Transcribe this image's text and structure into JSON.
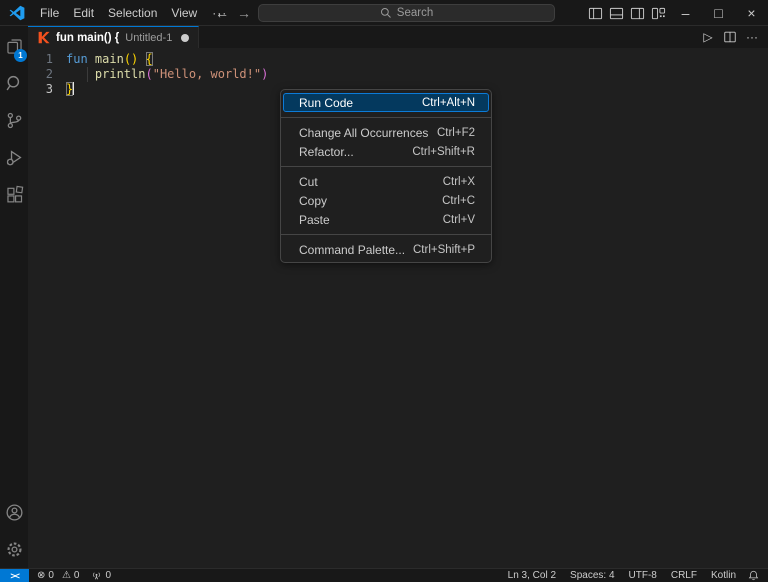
{
  "titlebar": {
    "menus": [
      {
        "label": "File"
      },
      {
        "label": "Edit"
      },
      {
        "label": "Selection"
      },
      {
        "label": "View"
      }
    ],
    "overflow_label": "···",
    "search": {
      "placeholder": "Search"
    }
  },
  "tabbar": {
    "tab": {
      "title": "fun main() {",
      "description": "Untitled-1",
      "modified": true,
      "language": "kotlin"
    }
  },
  "activity_bar": {
    "explorer_badge": "1"
  },
  "editor": {
    "lines": [
      {
        "num": "1",
        "tokens": [
          {
            "text": "fun ",
            "style": "keyword"
          },
          {
            "text": "main",
            "style": "function"
          },
          {
            "text": "()",
            "style": "bracket1"
          },
          {
            "text": " ",
            "style": "plain"
          },
          {
            "text": "{",
            "style": "bracket1",
            "matched": true
          }
        ]
      },
      {
        "num": "2",
        "tokens": [
          {
            "text": "    ",
            "style": "plain"
          },
          {
            "text": "println",
            "style": "function"
          },
          {
            "text": "(",
            "style": "bracket2"
          },
          {
            "text": "\"Hello, world!\"",
            "style": "string"
          },
          {
            "text": ")",
            "style": "bracket2"
          }
        ]
      },
      {
        "num": "3",
        "active": true,
        "cursor_after": true,
        "tokens": [
          {
            "text": "}",
            "style": "bracket1",
            "matched": true
          }
        ]
      }
    ]
  },
  "context_menu": {
    "items": [
      {
        "label": "Run Code",
        "shortcut": "Ctrl+Alt+N",
        "highlighted": true
      },
      {
        "separator": true
      },
      {
        "label": "Change All Occurrences",
        "shortcut": "Ctrl+F2"
      },
      {
        "label": "Refactor...",
        "shortcut": "Ctrl+Shift+R"
      },
      {
        "separator": true
      },
      {
        "label": "Cut",
        "shortcut": "Ctrl+X"
      },
      {
        "label": "Copy",
        "shortcut": "Ctrl+C"
      },
      {
        "label": "Paste",
        "shortcut": "Ctrl+V"
      },
      {
        "separator": true
      },
      {
        "label": "Command Palette...",
        "shortcut": "Ctrl+Shift+P"
      }
    ]
  },
  "statusbar": {
    "remote_label": "><",
    "errors": "0",
    "warnings": "0",
    "ports": "0",
    "right": [
      {
        "label": "Ln 3, Col 2"
      },
      {
        "label": "Spaces: 4"
      },
      {
        "label": "UTF-8"
      },
      {
        "label": "CRLF"
      },
      {
        "label": "Kotlin"
      }
    ]
  },
  "icons": {
    "back_arrow": "←",
    "forward_arrow": "→",
    "minimize": "–",
    "maximize": "□",
    "close": "×",
    "run": "▷",
    "more_actions": "···",
    "error": "⊗",
    "warning": "⚠"
  },
  "colors": {
    "accent": "#0078d4",
    "keyword": "#569cd6",
    "function": "#dcdcaa",
    "string": "#ce9178",
    "bracket_level1": "#ffd700",
    "bracket_level2": "#da70d6",
    "kotlin_icon": "#f4511e",
    "menu_highlight_bg": "#04395e"
  }
}
